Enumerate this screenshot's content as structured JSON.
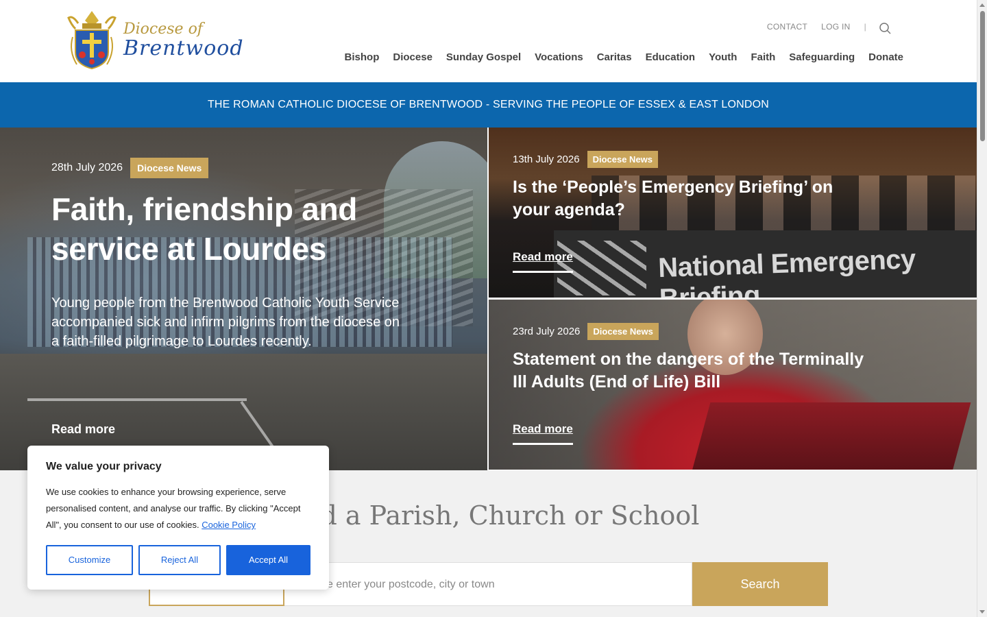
{
  "header": {
    "logo_line1": "Diocese of",
    "logo_line2": "Brentwood",
    "utility": {
      "contact": "CONTACT",
      "login": "LOG IN",
      "separator": "|"
    },
    "nav": [
      "Bishop",
      "Diocese",
      "Sunday Gospel",
      "Vocations",
      "Caritas",
      "Education",
      "Youth",
      "Faith",
      "Safeguarding",
      "Donate"
    ]
  },
  "banner": {
    "text": "THE ROMAN CATHOLIC DIOCESE OF BRENTWOOD - SERVING THE PEOPLE OF ESSEX & EAST LONDON"
  },
  "hero": {
    "main": {
      "date": "28th July 2026",
      "tag": "Diocese News",
      "title": "Faith, friendship and service at Lourdes",
      "description": "Young people from the Brentwood Catholic Youth Service accompanied sick and infirm pilgrims from the diocese on a faith-filled pilgrimage to Lourdes recently.",
      "read_more": "Read more"
    },
    "side": [
      {
        "date": "13th July 2026",
        "tag": "Diocese News",
        "title": "Is the ‘People’s Emergency Briefing’ on your agenda?",
        "read_more": "Read more",
        "image_text": "National Emergency Briefing"
      },
      {
        "date": "23rd July 2026",
        "tag": "Diocese News",
        "title": "Statement on the dangers of the Terminally Ill Adults (End of Life) Bill",
        "read_more": "Read more"
      }
    ]
  },
  "find": {
    "title": "Find a Parish, Church or School",
    "placeholder": "Please enter your postcode, city or town",
    "search_button": "Search"
  },
  "cookie": {
    "title": "We value your privacy",
    "text": "We use cookies to enhance your browsing experience, serve personalised content, and analyse our traffic. By clicking \"Accept All\", you consent to our use of cookies.",
    "link": "Cookie Policy",
    "customize": "Customize",
    "reject": "Reject All",
    "accept": "Accept All"
  },
  "colors": {
    "banner": "#0c66ad",
    "tag": "#c9a55b",
    "logo_blue": "#1f4e9e",
    "logo_gold": "#b8993f",
    "cookie_blue": "#1863dc"
  }
}
